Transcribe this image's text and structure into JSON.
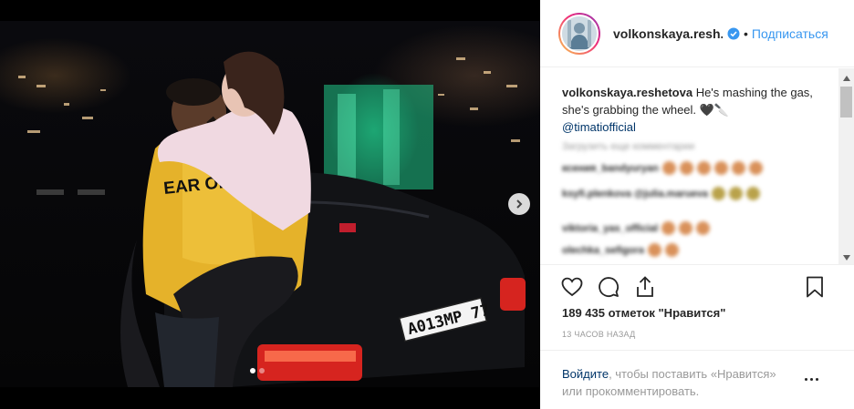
{
  "post": {
    "username": "volkonskaya.resh...",
    "follow_separator": "•",
    "follow_label": "Подписаться",
    "caption_username": "volkonskaya.reshetova",
    "caption_text": " He's mashing the gas, she's grabbing the wheel. 🖤🔪",
    "caption_mention": "@timatiofficial",
    "likes": "189 435 отметок \"Нравится\"",
    "timestamp": "13 ЧАСОВ НАЗАД",
    "license_plate": "A013MP 77"
  },
  "blurred_comments": [
    "Загрузить еще комментарии",
    "ксения_bandyuryan",
    "ksyfi.plenkova @julia.marueva",
    "viktoria_yas_official",
    "olechka_sefigora"
  ],
  "login_prompt": {
    "link": "Войдите",
    "text": ", чтобы поставить «Нравится» или прокомментировать."
  },
  "icons": {
    "verified": "verified-badge-icon",
    "like": "heart-icon",
    "comment": "comment-icon",
    "share": "share-icon",
    "save": "bookmark-icon",
    "next": "chevron-right-icon",
    "more": "more-options-icon"
  },
  "colors": {
    "link": "#3897f0",
    "mention": "#003569",
    "muted": "#999999",
    "jacket": "#e5b22a"
  },
  "carousel": {
    "slide_count": 2,
    "active_index": 0
  }
}
